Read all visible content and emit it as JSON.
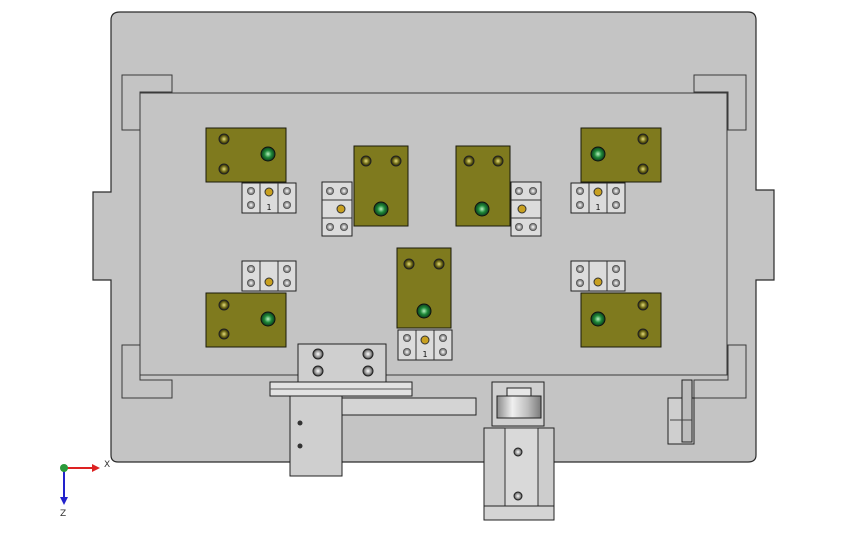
{
  "viewport": {
    "background": "#ffffff",
    "colors": {
      "plate": "#c4c4c4",
      "plate_edge": "#2a2a2a",
      "pad": "#7f7a1e",
      "bolt_green": "#1f8a3a",
      "steel": "#dcdcdc"
    }
  },
  "triad": {
    "x_label": "X",
    "z_label": "Z",
    "icons": [
      "x-axis-arrow-icon",
      "y-axis-sphere-icon",
      "z-axis-arrow-icon"
    ]
  },
  "block_labels": {
    "clamp_mark": "1"
  }
}
